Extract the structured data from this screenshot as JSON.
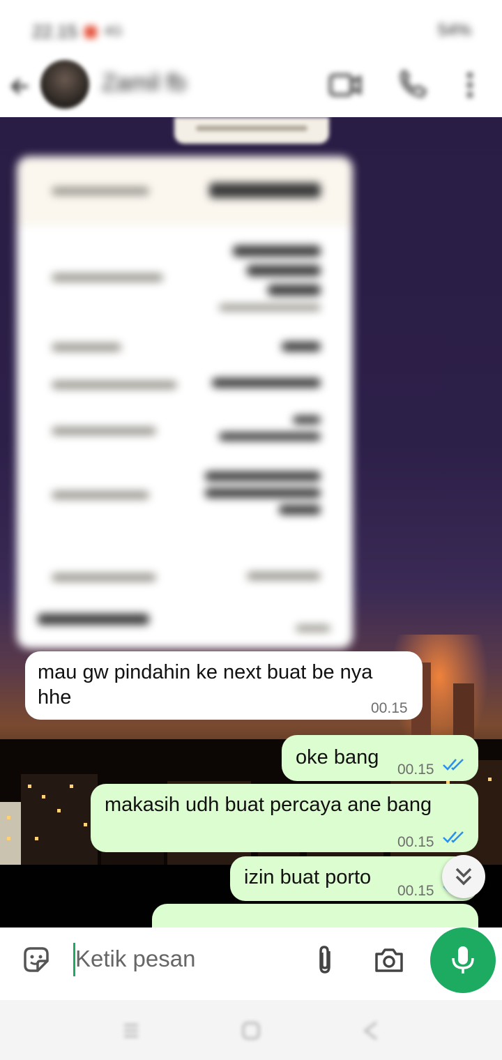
{
  "status_bar": {
    "time": "22.15",
    "signal_text": "4G",
    "battery": "54%"
  },
  "header": {
    "contact_name": "Zamil fb",
    "icons": [
      "back-arrow-icon",
      "video-call-icon",
      "voice-call-icon",
      "more-vertical-icon"
    ]
  },
  "messages": [
    {
      "direction": "incoming",
      "text": "mau gw pindahin ke next buat be nya hhe",
      "time": "00.15"
    },
    {
      "direction": "outgoing",
      "text": "oke bang",
      "time": "00.15",
      "status": "read"
    },
    {
      "direction": "outgoing",
      "text": "makasih udh buat percaya ane bang",
      "time": "00.15",
      "status": "read"
    },
    {
      "direction": "outgoing",
      "text": "izin buat porto",
      "time": "00.15",
      "status": "read"
    }
  ],
  "input": {
    "placeholder": "Ketik pesan",
    "icons": [
      "sticker-icon",
      "attach-icon",
      "camera-icon",
      "mic-icon"
    ]
  },
  "colors": {
    "accent": "#1daa61",
    "outgoing_bubble": "#dcfdd0",
    "incoming_bubble": "#ffffff",
    "read_tick": "#2b8ff0"
  }
}
